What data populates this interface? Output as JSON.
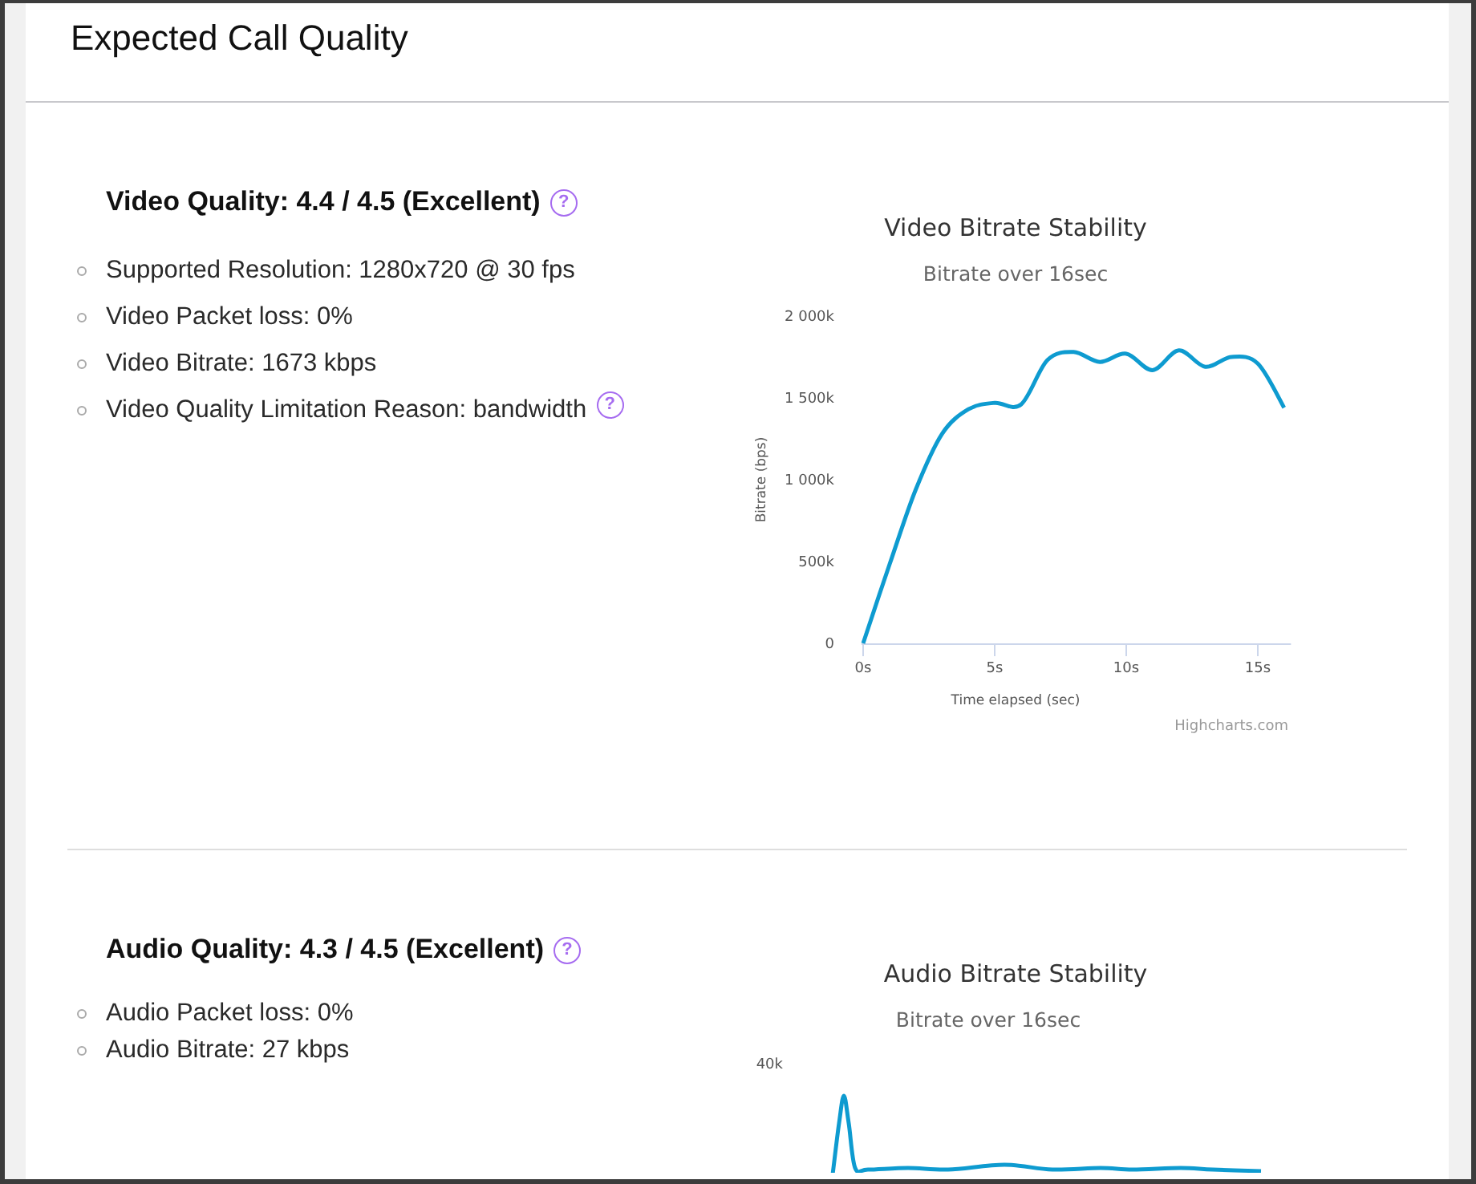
{
  "page": {
    "title": "Expected Call Quality"
  },
  "sections": [
    {
      "heading": "Video Quality: 4.4 / 4.5 (Excellent)",
      "help": "?",
      "items": [
        {
          "text": "Supported Resolution: 1280x720 @ 30 fps"
        },
        {
          "text": "Video Packet loss: 0%"
        },
        {
          "text": "Video Bitrate: 1673 kbps"
        },
        {
          "text": "Video Quality Limitation Reason: bandwidth",
          "help": "?"
        }
      ],
      "chart": {
        "kind": "line",
        "subtitle": "Bitrate over 16sec",
        "credit": "Highcharts.com",
        "chart_data": {
          "type": "line",
          "title": "Video Bitrate Stability",
          "xlabel": "Time elapsed (sec)",
          "ylabel": "Bitrate (bps)",
          "x": [
            0,
            1,
            2,
            3,
            4,
            5,
            6,
            7,
            8,
            9,
            10,
            11,
            12,
            13,
            14,
            15,
            16
          ],
          "series": [
            {
              "color": "#0e9bd0",
              "values": [
                0,
                480000,
                940000,
                1280000,
                1430000,
                1470000,
                1460000,
                1730000,
                1780000,
                1720000,
                1770000,
                1670000,
                1790000,
                1690000,
                1750000,
                1710000,
                1440000
              ]
            }
          ],
          "xlim": [
            0,
            16.2
          ],
          "ylim": [
            0,
            2000000
          ],
          "xticks": [
            {
              "value": 0,
              "label": "0s"
            },
            {
              "value": 5,
              "label": "5s"
            },
            {
              "value": 10,
              "label": "10s"
            },
            {
              "value": 15,
              "label": "15s"
            }
          ],
          "yticks": [
            {
              "value": 0,
              "label": "0"
            },
            {
              "value": 500000,
              "label": "500k"
            },
            {
              "value": 1000000,
              "label": "1 000k"
            },
            {
              "value": 1500000,
              "label": "1 500k"
            },
            {
              "value": 2000000,
              "label": "2 000k"
            }
          ]
        }
      }
    },
    {
      "heading": "Audio Quality: 4.3 / 4.5 (Excellent)",
      "help": "?",
      "items": [
        {
          "text": "Audio Packet loss: 0%"
        },
        {
          "text": "Audio Bitrate: 27 kbps"
        }
      ],
      "chart": {
        "kind": "picture",
        "title": "Audio Bitrate Stability",
        "subtitle": "Bitrate over 16sec",
        "tick_label": "40k",
        "color": "#0e9bd0"
      }
    }
  ]
}
